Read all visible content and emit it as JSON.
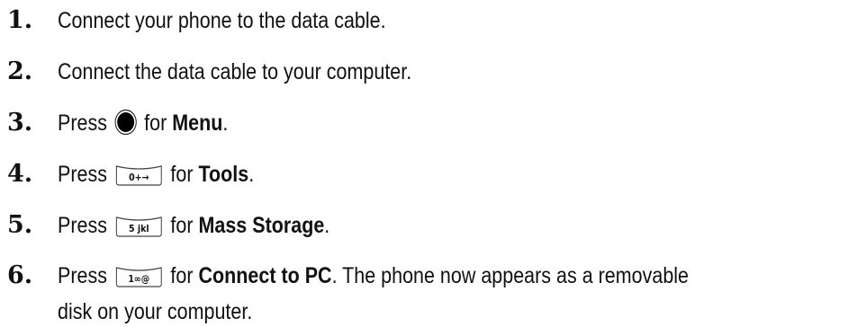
{
  "steps": [
    {
      "number": "1.",
      "text": "Connect your phone to the data cable."
    },
    {
      "number": "2.",
      "text": "Connect the data cable to your computer."
    },
    {
      "number": "3.",
      "before": "Press",
      "key_icon": "menu-ok-button-icon",
      "middle": "for",
      "bold": "Menu",
      "after": "."
    },
    {
      "number": "4.",
      "before": "Press",
      "key_icon": "key-0-icon",
      "key_label": "0+→",
      "middle": "for",
      "bold": "Tools",
      "after": "."
    },
    {
      "number": "5.",
      "before": "Press",
      "key_icon": "key-5-icon",
      "key_label": "5 jkl",
      "middle": "for",
      "bold": "Mass Storage",
      "after": "."
    },
    {
      "number": "6.",
      "before": "Press",
      "key_icon": "key-1-icon",
      "key_label": "1∞@",
      "middle": "for",
      "bold": "Connect to PC",
      "after": ". The phone now appears as a removable",
      "line2": "disk on your computer."
    }
  ]
}
